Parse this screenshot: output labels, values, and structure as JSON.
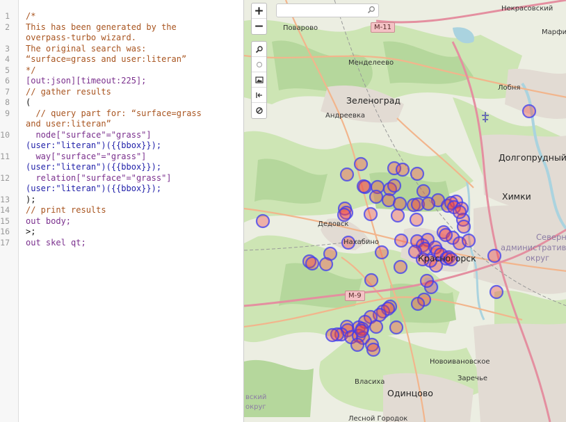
{
  "editor": {
    "line_numbers": [
      "1",
      "2",
      "3",
      "4",
      "5",
      "6",
      "7",
      "8",
      "9",
      "10",
      "11",
      "12",
      "13",
      "14",
      "15",
      "16",
      "17"
    ],
    "lines": [
      {
        "n": "1",
        "text": "/*"
      },
      {
        "n": "2",
        "text": "This has been generated by the"
      },
      {
        "n": "",
        "text": "overpass-turbo wizard."
      },
      {
        "n": "3",
        "text": "The original search was:"
      },
      {
        "n": "4",
        "text": "“surface=grass and user:literan”"
      },
      {
        "n": "5",
        "text": "*/"
      },
      {
        "n": "6",
        "text": "[out:json][timeout:225];"
      },
      {
        "n": "7",
        "text": "// gather results"
      },
      {
        "n": "8",
        "text": "("
      },
      {
        "n": "9",
        "text": "  // query part for: “surface=grass"
      },
      {
        "n": "",
        "text": "and user:literan”"
      },
      {
        "n": "10",
        "text": "  node[\"surface\"=\"grass\"]"
      },
      {
        "n": "",
        "text": "(user:\"literan\")({{bbox}});"
      },
      {
        "n": "11",
        "text": "  way[\"surface\"=\"grass\"]"
      },
      {
        "n": "",
        "text": "(user:\"literan\")({{bbox}});"
      },
      {
        "n": "12",
        "text": "  relation[\"surface\"=\"grass\"]"
      },
      {
        "n": "",
        "text": "(user:\"literan\")({{bbox}});"
      },
      {
        "n": "13",
        "text": ");"
      },
      {
        "n": "14",
        "text": "// print results"
      },
      {
        "n": "15",
        "text": "out body;"
      },
      {
        "n": "16",
        "text": ">;"
      },
      {
        "n": "17",
        "text": "out skel qt;"
      }
    ]
  },
  "map": {
    "search_placeholder": "",
    "zoom_in_label": "+",
    "zoom_out_label": "−",
    "tools": [
      "search-icon",
      "locate-icon",
      "image-icon",
      "fit-icon",
      "no-icon"
    ],
    "places": [
      {
        "id": "nekrasovsky",
        "text": "Некрасовский"
      },
      {
        "id": "povarovo",
        "text": "Поварово"
      },
      {
        "id": "marfino",
        "text": "Марфин"
      },
      {
        "id": "mendeleevo",
        "text": "Менделеево"
      },
      {
        "id": "lobnya",
        "text": "Лобня"
      },
      {
        "id": "zelenograd",
        "text": "Зеленоград"
      },
      {
        "id": "andreevka",
        "text": "Андреевка"
      },
      {
        "id": "dolgoprudny",
        "text": "Долгопрудный"
      },
      {
        "id": "khimki",
        "text": "Химки"
      },
      {
        "id": "dedovsk",
        "text": "Дедовск"
      },
      {
        "id": "nakhabino",
        "text": "Нахабино"
      },
      {
        "id": "krasnogorsk",
        "text": "Красногорск"
      },
      {
        "id": "sever1",
        "text": "Северный"
      },
      {
        "id": "sever2",
        "text": "административный"
      },
      {
        "id": "sever3",
        "text": "округ"
      },
      {
        "id": "novoivanovskoe",
        "text": "Новоивановское"
      },
      {
        "id": "zarechye",
        "text": "Заречье"
      },
      {
        "id": "vlasikha",
        "text": "Власиха"
      },
      {
        "id": "odintsovo",
        "text": "Одинцово"
      },
      {
        "id": "zvenig",
        "text": "вский"
      },
      {
        "id": "zvenig2",
        "text": "округ"
      },
      {
        "id": "lesnoy",
        "text": "Лесной Городок"
      }
    ],
    "highways": [
      "M-11",
      "M-9"
    ],
    "colors": {
      "marker_fill": "#f03c3c",
      "marker_stroke": "#3c3cf0",
      "green": "#cfe6b8",
      "forest": "#b8d9a0",
      "urban": "#e3dcd5",
      "water": "#aad3df",
      "road": "#f4b38a",
      "motorway": "#e892a2"
    }
  }
}
